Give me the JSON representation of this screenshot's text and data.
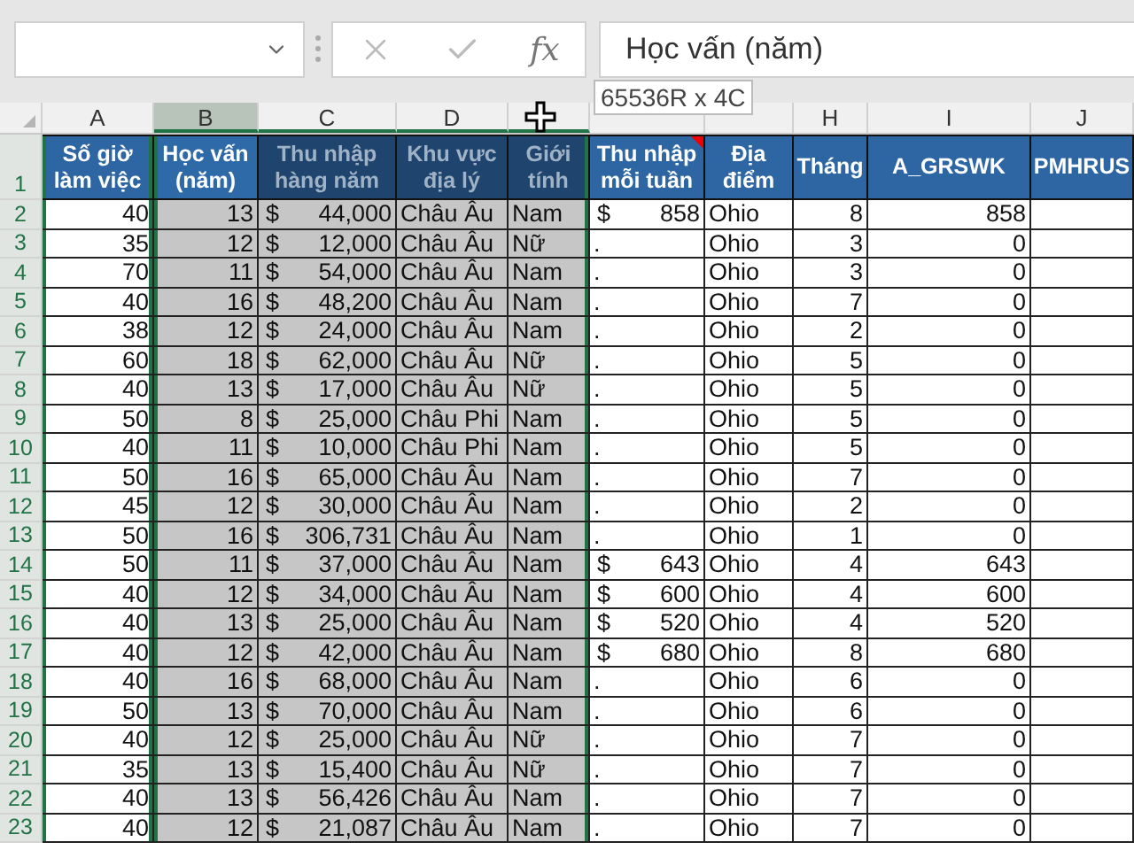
{
  "formula_bar": {
    "function_label": "fx",
    "value": "Học vấn (năm)"
  },
  "selection_tooltip": "65536R x 4C",
  "columns": [
    {
      "letter": "A",
      "header": "Số giờ làm việc",
      "kind": "number",
      "selected": false,
      "active": false,
      "marked": true,
      "comment": false
    },
    {
      "letter": "B",
      "header": "Học vấn (năm)",
      "kind": "number",
      "selected": true,
      "active": true,
      "marked": false,
      "comment": false
    },
    {
      "letter": "C",
      "header": "Thu nhập hàng năm",
      "kind": "currency",
      "selected": true,
      "active": false,
      "marked": false,
      "comment": false
    },
    {
      "letter": "D",
      "header": "Khu vực địa lý",
      "kind": "text",
      "selected": true,
      "active": false,
      "marked": false,
      "comment": false
    },
    {
      "header": "Giới tính",
      "kind": "text",
      "selected": true,
      "active": false,
      "marked": false,
      "comment": false
    },
    {
      "header": "Thu nhập mỗi tuần",
      "kind": "currency",
      "selected": false,
      "active": false,
      "marked": false,
      "comment": true
    },
    {
      "header": "Địa điểm",
      "kind": "text",
      "selected": false,
      "active": false,
      "marked": false,
      "comment": false
    },
    {
      "letter": "H",
      "header": "Tháng",
      "kind": "number",
      "selected": false,
      "active": false,
      "marked": false,
      "comment": false
    },
    {
      "letter": "I",
      "header": "A_GRSWK",
      "kind": "number",
      "selected": false,
      "active": false,
      "marked": false,
      "comment": false
    },
    {
      "letter": "J",
      "header": "PMHRUS",
      "kind": "text",
      "selected": false,
      "active": false,
      "marked": false,
      "comment": false
    }
  ],
  "header_row_number": "1",
  "rows": [
    {
      "number": "2",
      "cells": [
        "40",
        "13",
        {
          "symbol": "$",
          "amount": "44,000"
        },
        "Châu Âu",
        "Nam",
        {
          "symbol": "$",
          "amount": "858"
        },
        "Ohio",
        "8",
        "858"
      ]
    },
    {
      "number": "3",
      "cells": [
        "35",
        "12",
        {
          "symbol": "$",
          "amount": "12,000"
        },
        "Châu Âu",
        "Nữ",
        ".",
        "Ohio",
        "3",
        "0"
      ]
    },
    {
      "number": "4",
      "cells": [
        "70",
        "11",
        {
          "symbol": "$",
          "amount": "54,000"
        },
        "Châu Âu",
        "Nam",
        ".",
        "Ohio",
        "3",
        "0"
      ]
    },
    {
      "number": "5",
      "cells": [
        "40",
        "16",
        {
          "symbol": "$",
          "amount": "48,200"
        },
        "Châu Âu",
        "Nam",
        ".",
        "Ohio",
        "7",
        "0"
      ]
    },
    {
      "number": "6",
      "cells": [
        "38",
        "12",
        {
          "symbol": "$",
          "amount": "24,000"
        },
        "Châu Âu",
        "Nam",
        ".",
        "Ohio",
        "2",
        "0"
      ]
    },
    {
      "number": "7",
      "cells": [
        "60",
        "18",
        {
          "symbol": "$",
          "amount": "62,000"
        },
        "Châu Âu",
        "Nữ",
        ".",
        "Ohio",
        "5",
        "0"
      ]
    },
    {
      "number": "8",
      "cells": [
        "40",
        "13",
        {
          "symbol": "$",
          "amount": "17,000"
        },
        "Châu Âu",
        "Nữ",
        ".",
        "Ohio",
        "5",
        "0"
      ]
    },
    {
      "number": "9",
      "cells": [
        "50",
        "8",
        {
          "symbol": "$",
          "amount": "25,000"
        },
        "Châu Phi",
        "Nam",
        ".",
        "Ohio",
        "5",
        "0"
      ]
    },
    {
      "number": "10",
      "cells": [
        "40",
        "11",
        {
          "symbol": "$",
          "amount": "10,000"
        },
        "Châu Phi",
        "Nam",
        ".",
        "Ohio",
        "5",
        "0"
      ]
    },
    {
      "number": "11",
      "cells": [
        "50",
        "16",
        {
          "symbol": "$",
          "amount": "65,000"
        },
        "Châu Âu",
        "Nam",
        ".",
        "Ohio",
        "7",
        "0"
      ]
    },
    {
      "number": "12",
      "cells": [
        "45",
        "12",
        {
          "symbol": "$",
          "amount": "30,000"
        },
        "Châu Âu",
        "Nam",
        ".",
        "Ohio",
        "2",
        "0"
      ]
    },
    {
      "number": "13",
      "cells": [
        "50",
        "16",
        {
          "symbol": "$",
          "amount": "306,731"
        },
        "Châu Âu",
        "Nam",
        ".",
        "Ohio",
        "1",
        "0"
      ]
    },
    {
      "number": "14",
      "cells": [
        "50",
        "11",
        {
          "symbol": "$",
          "amount": "37,000"
        },
        "Châu Âu",
        "Nam",
        {
          "symbol": "$",
          "amount": "643"
        },
        "Ohio",
        "4",
        "643"
      ]
    },
    {
      "number": "15",
      "cells": [
        "40",
        "12",
        {
          "symbol": "$",
          "amount": "34,000"
        },
        "Châu Âu",
        "Nam",
        {
          "symbol": "$",
          "amount": "600"
        },
        "Ohio",
        "4",
        "600"
      ]
    },
    {
      "number": "16",
      "cells": [
        "40",
        "13",
        {
          "symbol": "$",
          "amount": "25,000"
        },
        "Châu Âu",
        "Nam",
        {
          "symbol": "$",
          "amount": "520"
        },
        "Ohio",
        "4",
        "520"
      ]
    },
    {
      "number": "17",
      "cells": [
        "40",
        "12",
        {
          "symbol": "$",
          "amount": "42,000"
        },
        "Châu Âu",
        "Nam",
        {
          "symbol": "$",
          "amount": "680"
        },
        "Ohio",
        "8",
        "680"
      ]
    },
    {
      "number": "18",
      "cells": [
        "40",
        "16",
        {
          "symbol": "$",
          "amount": "68,000"
        },
        "Châu Âu",
        "Nam",
        ".",
        "Ohio",
        "6",
        "0"
      ]
    },
    {
      "number": "19",
      "cells": [
        "50",
        "13",
        {
          "symbol": "$",
          "amount": "70,000"
        },
        "Châu Âu",
        "Nam",
        ".",
        "Ohio",
        "6",
        "0"
      ]
    },
    {
      "number": "20",
      "cells": [
        "40",
        "12",
        {
          "symbol": "$",
          "amount": "25,000"
        },
        "Châu Âu",
        "Nữ",
        ".",
        "Ohio",
        "7",
        "0"
      ]
    },
    {
      "number": "21",
      "cells": [
        "35",
        "13",
        {
          "symbol": "$",
          "amount": "15,400"
        },
        "Châu Âu",
        "Nữ",
        ".",
        "Ohio",
        "7",
        "0"
      ]
    },
    {
      "number": "22",
      "cells": [
        "40",
        "13",
        {
          "symbol": "$",
          "amount": "56,426"
        },
        "Châu Âu",
        "Nam",
        ".",
        "Ohio",
        "7",
        "0"
      ]
    },
    {
      "number": "23",
      "cells": [
        "40",
        "12",
        {
          "symbol": "$",
          "amount": "21,087"
        },
        "Châu Âu",
        "Nam",
        ".",
        "Ohio",
        "7",
        "0"
      ]
    }
  ]
}
